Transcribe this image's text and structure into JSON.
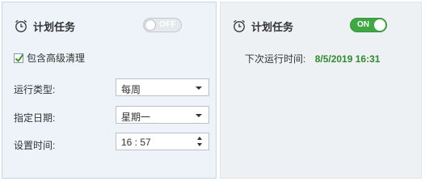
{
  "left_panel": {
    "title": "计划任务",
    "toggle": {
      "state_label": "OFF",
      "is_on": false
    },
    "include_advanced_clean": {
      "label": "包含高级清理",
      "checked": true
    },
    "run_type": {
      "label": "运行类型:",
      "value": "每周"
    },
    "date": {
      "label": "指定日期:",
      "value": "星期一"
    },
    "time": {
      "label": "设置时间:",
      "value": "16 : 57"
    }
  },
  "right_panel": {
    "title": "计划任务",
    "toggle": {
      "state_label": "ON",
      "is_on": true
    },
    "next_run": {
      "label": "下次运行时间:",
      "value": "8/5/2019 16:31"
    }
  },
  "colors": {
    "toggle_on": "#3fa843",
    "next_run_time": "#2e8b2e",
    "checkmark": "#3a9a2f",
    "left_panel_bg": "#edf3f8"
  },
  "icons": [
    "alarm-clock-icon",
    "checkmark-icon",
    "dropdown-arrow-icon",
    "spin-up-icon",
    "spin-down-icon"
  ]
}
